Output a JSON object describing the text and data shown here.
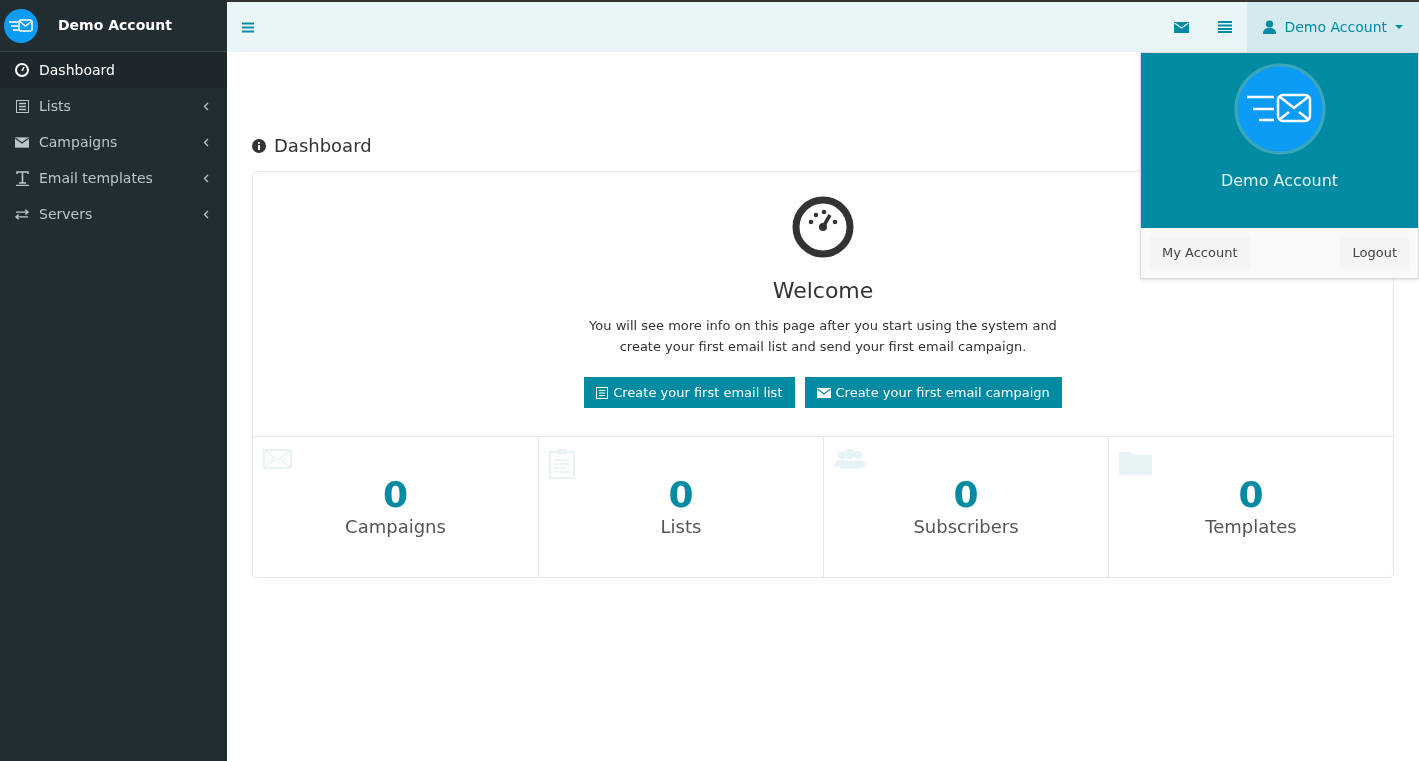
{
  "brand": {
    "title": "Demo Account"
  },
  "sidebar": {
    "items": [
      {
        "label": "Dashboard",
        "selected": true,
        "expandable": false
      },
      {
        "label": "Lists",
        "selected": false,
        "expandable": true
      },
      {
        "label": "Campaigns",
        "selected": false,
        "expandable": true
      },
      {
        "label": "Email templates",
        "selected": false,
        "expandable": true
      },
      {
        "label": "Servers",
        "selected": false,
        "expandable": true
      }
    ]
  },
  "topbar": {
    "user_menu": {
      "label": "Demo Account",
      "expanded": true
    }
  },
  "user_dropdown": {
    "name": "Demo Account",
    "buttons": [
      "My Account",
      "Logout"
    ]
  },
  "page": {
    "title": "Dashboard",
    "welcome": {
      "heading": "Welcome",
      "text": "You will see more info on this page after you start using the system and create your first email list and send your first email campaign.",
      "buttons": [
        "Create your first email list",
        "Create your first email campaign"
      ]
    },
    "stats": [
      {
        "value": "0",
        "label": "Campaigns"
      },
      {
        "value": "0",
        "label": "Lists"
      },
      {
        "value": "0",
        "label": "Subscribers"
      },
      {
        "value": "0",
        "label": "Templates"
      }
    ]
  }
}
